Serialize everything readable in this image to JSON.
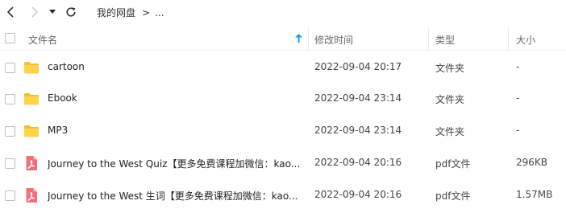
{
  "breadcrumb": {
    "root": "我的网盘",
    "separator": ">",
    "ellipsis": "..."
  },
  "header": {
    "name": "文件名",
    "modified": "修改时间",
    "type": "类型",
    "size": "大小"
  },
  "colors": {
    "folder": "#FFD24D",
    "folder_back": "#F7BE2B",
    "pdf": "#F2707A",
    "sort_arrow": "#1D9BF0"
  },
  "rows": [
    {
      "icon": "folder-icon",
      "name": "cartoon",
      "date": "2022-09-04 20:17",
      "type": "文件夹",
      "size": "-"
    },
    {
      "icon": "folder-icon",
      "name": "Ebook",
      "date": "2022-09-04 23:14",
      "type": "文件夹",
      "size": "-"
    },
    {
      "icon": "folder-icon",
      "name": "MP3",
      "date": "2022-09-04 23:14",
      "type": "文件夹",
      "size": "-"
    },
    {
      "icon": "pdf-icon",
      "name": "Journey to the West Quiz【更多免费课程加微信：kao...",
      "date": "2022-09-04 20:16",
      "type": "pdf文件",
      "size": "296KB"
    },
    {
      "icon": "pdf-icon",
      "name": "Journey to the West 生词【更多免费课程加微信：kao...",
      "date": "2022-09-04 20:16",
      "type": "pdf文件",
      "size": "1.57MB"
    }
  ]
}
